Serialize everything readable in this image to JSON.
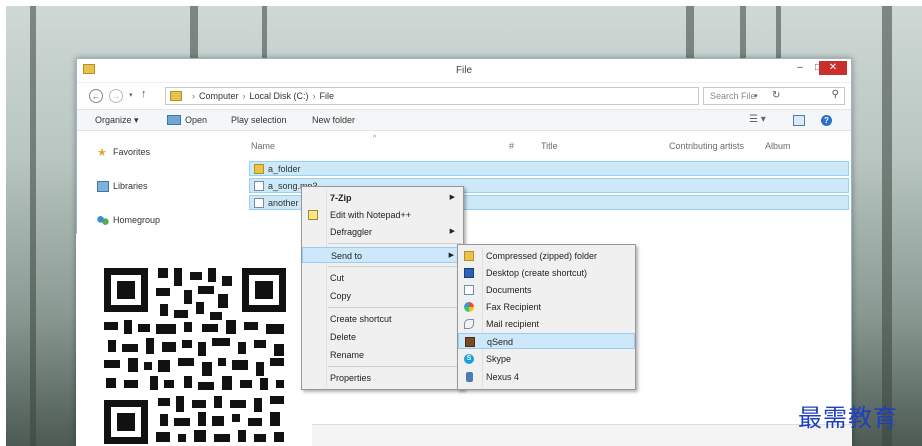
{
  "window": {
    "title": "File",
    "controls": {
      "minimize": "‒",
      "maximize": "□",
      "close": "✕"
    }
  },
  "address": {
    "crumbs": [
      "Computer",
      "Local Disk (C:)",
      "File"
    ],
    "search_placeholder": "Search File"
  },
  "toolbar": {
    "organize": "Organize ▾",
    "open": "Open",
    "play_selection": "Play selection",
    "new_folder": "New folder"
  },
  "navpane": {
    "items": [
      {
        "label": "Favorites",
        "icon": "star-icon"
      },
      {
        "label": "Libraries",
        "icon": "library-icon"
      },
      {
        "label": "Homegroup",
        "icon": "homegroup-icon"
      }
    ]
  },
  "columns": {
    "name": "Name",
    "number": "#",
    "title": "Title",
    "artists": "Contributing artists",
    "album": "Album"
  },
  "files": [
    {
      "name": "a_folder",
      "type": "folder"
    },
    {
      "name": "a_song.mp3",
      "type": "audio"
    },
    {
      "name": "another",
      "type": "audio"
    }
  ],
  "context_menu": {
    "items": [
      {
        "label": "7-Zip",
        "submenu": true
      },
      {
        "label": "Edit with Notepad++",
        "submenu": false
      },
      {
        "label": "Defraggler",
        "submenu": true
      },
      {
        "label": "Send to",
        "submenu": true
      },
      {
        "label": "Cut",
        "submenu": false
      },
      {
        "label": "Copy",
        "submenu": false
      },
      {
        "label": "Create shortcut",
        "submenu": false
      },
      {
        "label": "Delete",
        "submenu": false
      },
      {
        "label": "Rename",
        "submenu": false
      },
      {
        "label": "Properties",
        "submenu": false
      }
    ],
    "highlighted": "Send to"
  },
  "send_to_menu": {
    "items": [
      {
        "label": "Compressed (zipped) folder",
        "icon": "zip-folder-icon"
      },
      {
        "label": "Desktop (create shortcut)",
        "icon": "desktop-icon"
      },
      {
        "label": "Documents",
        "icon": "documents-icon"
      },
      {
        "label": "Fax Recipient",
        "icon": "fax-icon"
      },
      {
        "label": "Mail recipient",
        "icon": "mail-icon"
      },
      {
        "label": "qSend",
        "icon": "qsend-icon"
      },
      {
        "label": "Skype",
        "icon": "skype-icon"
      },
      {
        "label": "Nexus 4",
        "icon": "phone-icon"
      }
    ],
    "highlighted": "qSend"
  },
  "watermark": "最需教育",
  "colors": {
    "selection": "#cde8f7",
    "close_button": "#c9302c",
    "watermark": "#1f3fbf"
  }
}
